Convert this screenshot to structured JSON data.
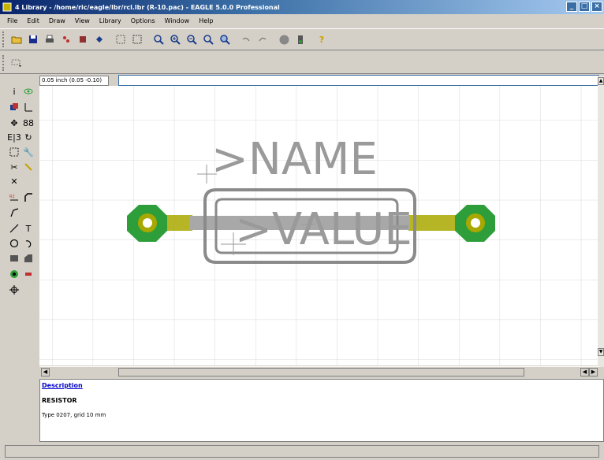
{
  "window": {
    "title": "4 Library - /home/ric/eagle/lbr/rcl.lbr (R-10.pac) - EAGLE 5.0.0 Professional",
    "buttons": [
      "minimize-icon",
      "maximize-icon",
      "close-icon"
    ]
  },
  "menu": {
    "items": [
      "File",
      "Edit",
      "Draw",
      "View",
      "Library",
      "Options",
      "Window",
      "Help"
    ]
  },
  "toolbar": {
    "icons": [
      "open-icon",
      "save-icon",
      "print-icon",
      "cam-icon",
      "script-icon",
      "run-ulp-icon",
      "grid-icon",
      "grid-alt-icon",
      "zoom-fit-icon",
      "zoom-in-icon",
      "zoom-out-icon",
      "zoom-redraw-icon",
      "zoom-select-icon",
      "undo-icon",
      "redo-icon",
      "stop-icon",
      "go-icon",
      "help-icon"
    ]
  },
  "coord": {
    "value": "0.05 inch (0.05 -0.10)",
    "command": ""
  },
  "canvas": {
    "name_label": ">NAME",
    "value_label": ">VALUE",
    "pad_color": "#2e9e3a",
    "wire_color": "#a0a000",
    "silk_color": "#8a8a8a"
  },
  "description": {
    "link": "Description",
    "name": "RESISTOR",
    "text": "Type 0207, grid 10 mm"
  },
  "status": {
    "text": ""
  }
}
